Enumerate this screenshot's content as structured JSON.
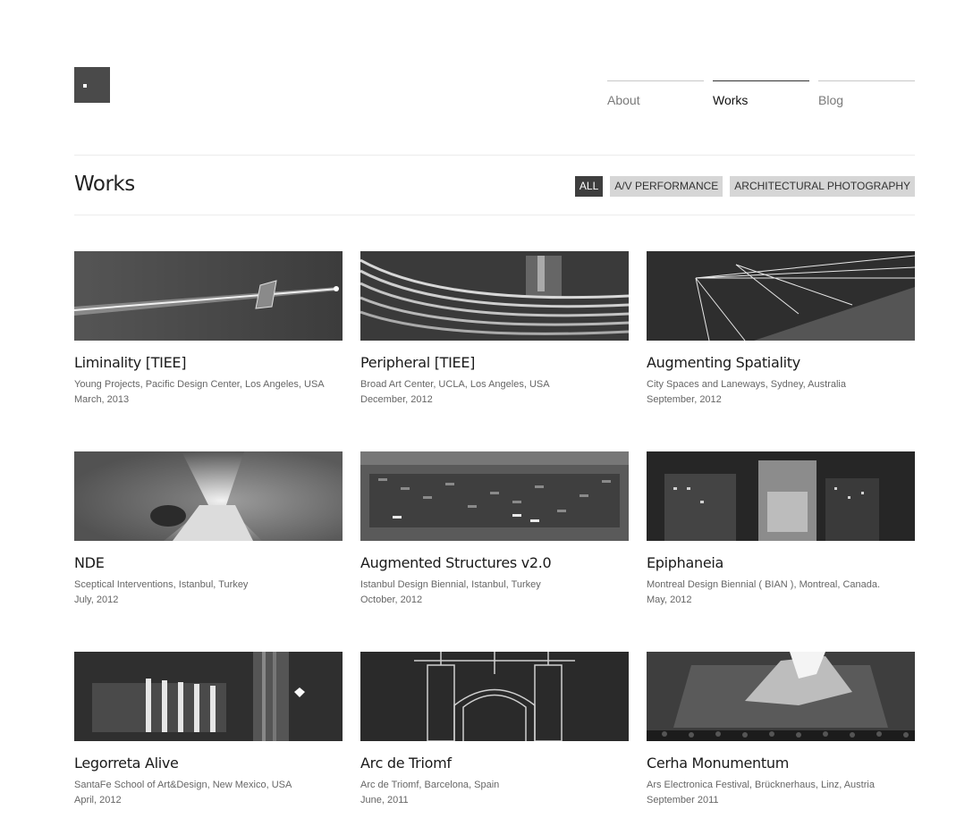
{
  "logo": {
    "icon": "square-logo-icon"
  },
  "nav": [
    {
      "label": "About",
      "active": false
    },
    {
      "label": "Works",
      "active": true
    },
    {
      "label": "Blog",
      "active": false
    }
  ],
  "page": {
    "title": "Works"
  },
  "filters": [
    {
      "label": "ALL",
      "active": true
    },
    {
      "label": "A/V PERFORMANCE",
      "active": false
    },
    {
      "label": "ARCHITECTURAL PHOTOGRAPHY",
      "active": false
    }
  ],
  "works": [
    {
      "title": "Liminality [TIEE]",
      "venue": "Young Projects, Pacific Design Center, Los Angeles, USA",
      "date": "March, 2013"
    },
    {
      "title": "Peripheral [TIEE]",
      "venue": "Broad Art Center, UCLA, Los Angeles, USA",
      "date": "December, 2012"
    },
    {
      "title": "Augmenting Spatiality",
      "venue": "City Spaces and Laneways, Sydney, Australia",
      "date": "September, 2012"
    },
    {
      "title": "NDE",
      "venue": "Sceptical Interventions, Istanbul, Turkey",
      "date": "July, 2012"
    },
    {
      "title": "Augmented Structures v2.0",
      "venue": "Istanbul Design Biennial, Istanbul, Turkey",
      "date": "October, 2012"
    },
    {
      "title": "Epiphaneia",
      "venue": "Montreal Design Biennial ( BIAN ), Montreal, Canada.",
      "date": "May, 2012"
    },
    {
      "title": "Legorreta Alive",
      "venue": "SantaFe School of Art&Design, New Mexico, USA",
      "date": "April, 2012"
    },
    {
      "title": "Arc de Triomf",
      "venue": "Arc de Triomf, Barcelona, Spain",
      "date": "June, 2011"
    },
    {
      "title": "Cerha Monumentum",
      "venue": "Ars Electronica Festival, Brücknerhaus, Linz, Austria",
      "date": "September 2011"
    }
  ],
  "colors": {
    "accent": "#3e3e3e",
    "filter_bg": "#d6d6d6",
    "text": "#333333"
  }
}
